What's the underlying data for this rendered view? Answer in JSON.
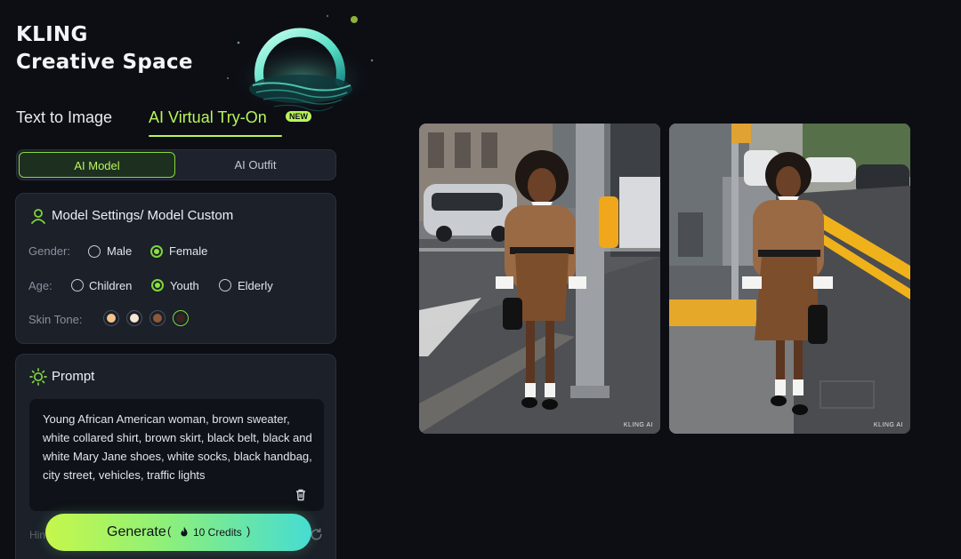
{
  "brand": {
    "line1": "KLING",
    "line2": "Creative Space"
  },
  "tabs": [
    {
      "label": "Text to Image",
      "active": false
    },
    {
      "label": "AI Virtual Try-On",
      "active": true,
      "badge": "NEW"
    }
  ],
  "segment": {
    "model_label": "AI Model",
    "outfit_label": "AI Outfit",
    "selected": "AI Model"
  },
  "settings": {
    "title": "Model Settings/ Model Custom",
    "gender_label": "Gender:",
    "gender_options": [
      "Male",
      "Female"
    ],
    "gender_selected": "Female",
    "age_label": "Age:",
    "age_options": [
      "Children",
      "Youth",
      "Elderly"
    ],
    "age_selected": "Youth",
    "skin_label": "Skin Tone:",
    "skin_tones": [
      "#f2c38e",
      "#f7e6d4",
      "#8a5a3a",
      "#3b241a"
    ],
    "skin_selected_index": 3
  },
  "prompt": {
    "title": "Prompt",
    "text": "Young African American woman, brown sweater, white collared shirt, brown skirt, black belt, black and white Mary Jane shoes, white socks, black handbag, city street, vehicles, traffic lights",
    "hint_partial": "Hin"
  },
  "generate": {
    "label": "Generate",
    "credits_open": "(",
    "credits": "10 Credits",
    "credits_close": ")"
  },
  "results": [
    {
      "watermark": "KLING AI"
    },
    {
      "watermark": "KLING AI"
    }
  ],
  "colors": {
    "accent": "#b9f45a",
    "background": "#0c0e14",
    "card": "#1b2029"
  }
}
